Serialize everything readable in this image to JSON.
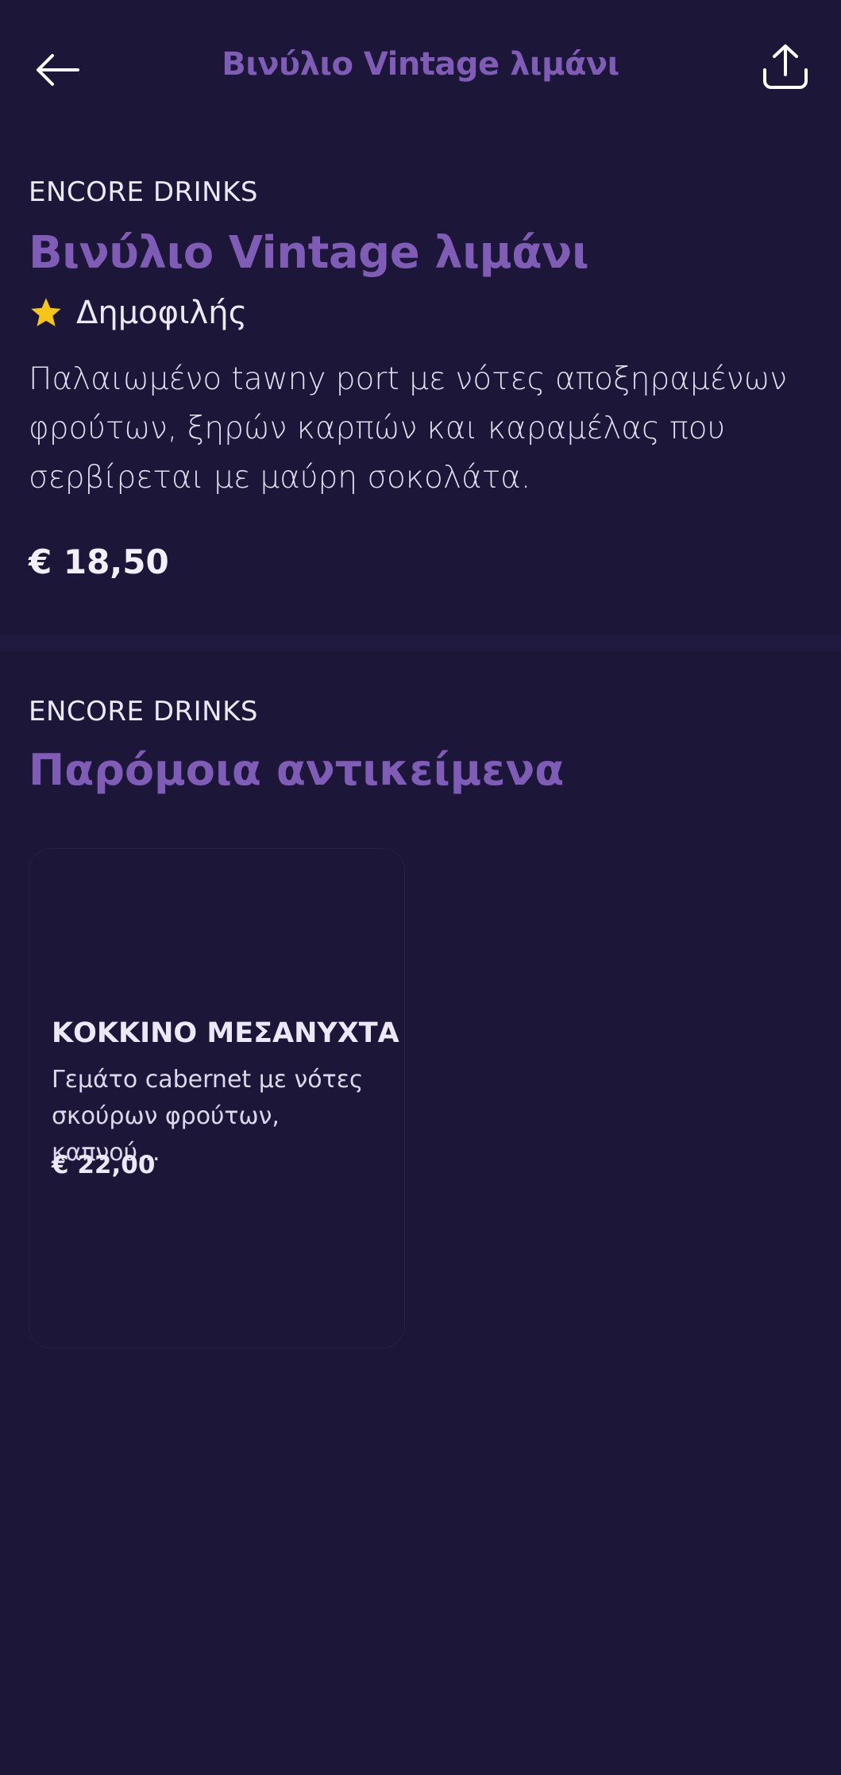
{
  "header": {
    "title": "Βινύλιο Vintage λιμάνι",
    "back_icon": "arrow-left-icon",
    "share_icon": "share-icon"
  },
  "product": {
    "brand": "ENCORE DRINKS",
    "title": "Βινύλιο Vintage λιμάνι",
    "badge_icon": "star-icon",
    "badge_label": "Δημοφιλής",
    "description": "Παλαιωμένο tawny port με νότες αποξηραμένων φρούτων, ξηρών καρπών και καραμέλας που σερβίρεται με μαύρη σοκολάτα.",
    "price": "€ 18,50"
  },
  "similar": {
    "brand": "ENCORE DRINKS",
    "title": "Παρόμοια αντικείμενα",
    "items": [
      {
        "name": "ΚΟΚΚΙΝΟ ΜΕΣΑΝΥΧΤΑ",
        "description": "Γεμάτο cabernet με νότες σκούρων φρούτων, καπνού...",
        "price": "€ 22,00"
      }
    ]
  },
  "colors": {
    "background": "#1c1638",
    "accent": "#7f5cb5",
    "text": "#ece8f6",
    "star": "#f5c518"
  }
}
